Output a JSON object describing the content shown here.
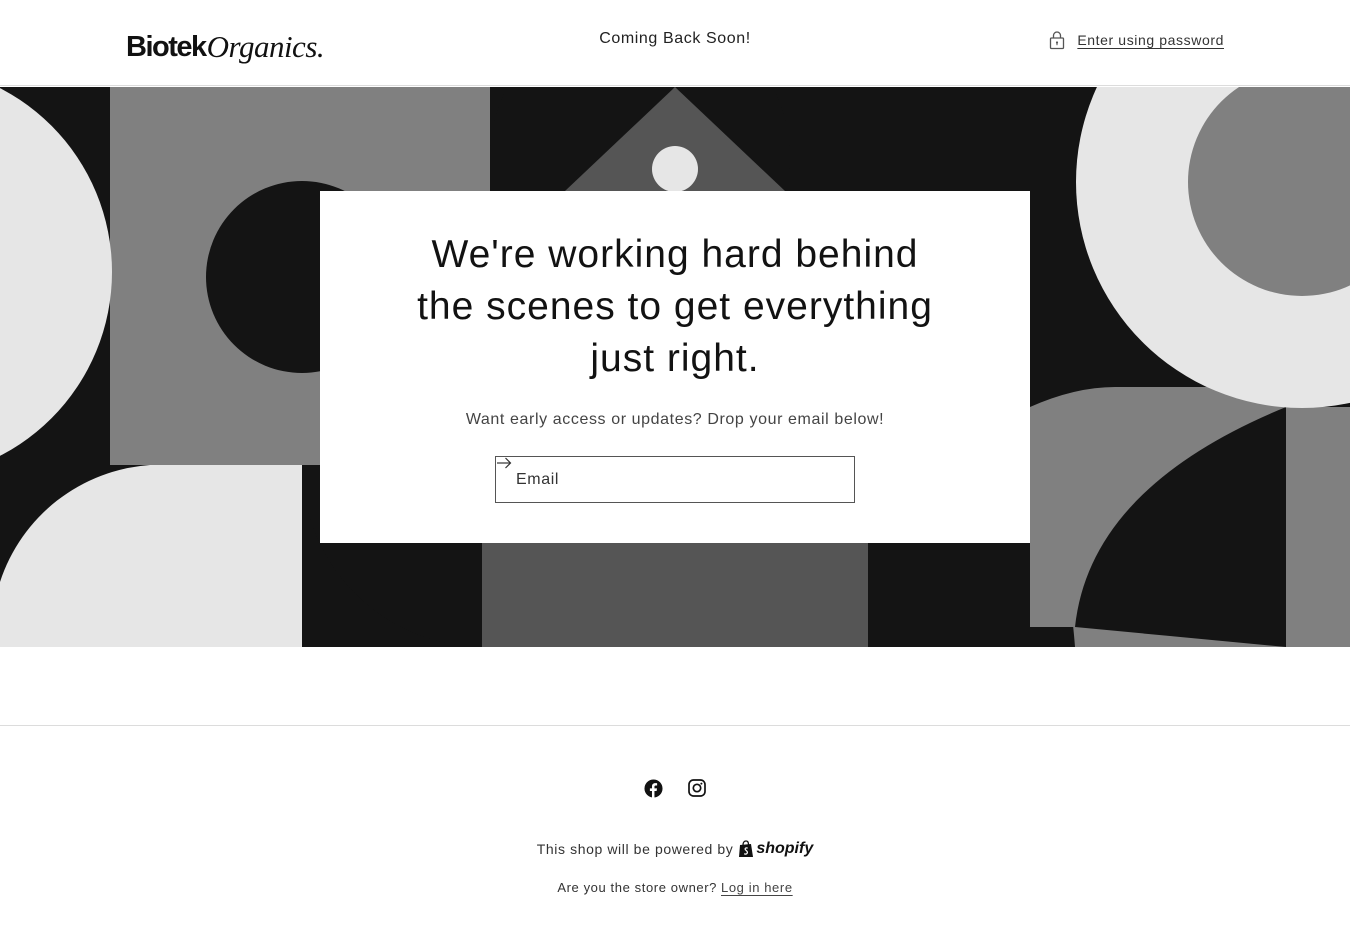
{
  "header": {
    "logo_part1": "Biotek",
    "logo_part2": "Organics.",
    "title": "Coming Back Soon!",
    "password_link": "Enter using password",
    "lock_icon": "lock-icon"
  },
  "hero": {
    "heading": "We're working hard behind the scenes to get everything just right.",
    "subtext": "Want early access or updates? Drop your email below!",
    "email_placeholder": "Email",
    "submit_icon": "arrow-right-icon"
  },
  "colors": {
    "black": "#141414",
    "dark_gray": "#555555",
    "mid_gray": "#808080",
    "light_gray": "#e6e6e6",
    "white": "#ffffff"
  },
  "footer": {
    "social": [
      {
        "name": "Facebook",
        "icon": "facebook-icon"
      },
      {
        "name": "Instagram",
        "icon": "instagram-icon"
      }
    ],
    "powered_text": "This shop will be powered by",
    "shopify_label": "shopify",
    "owner_text": "Are you the store owner?",
    "login_link": "Log in here"
  }
}
